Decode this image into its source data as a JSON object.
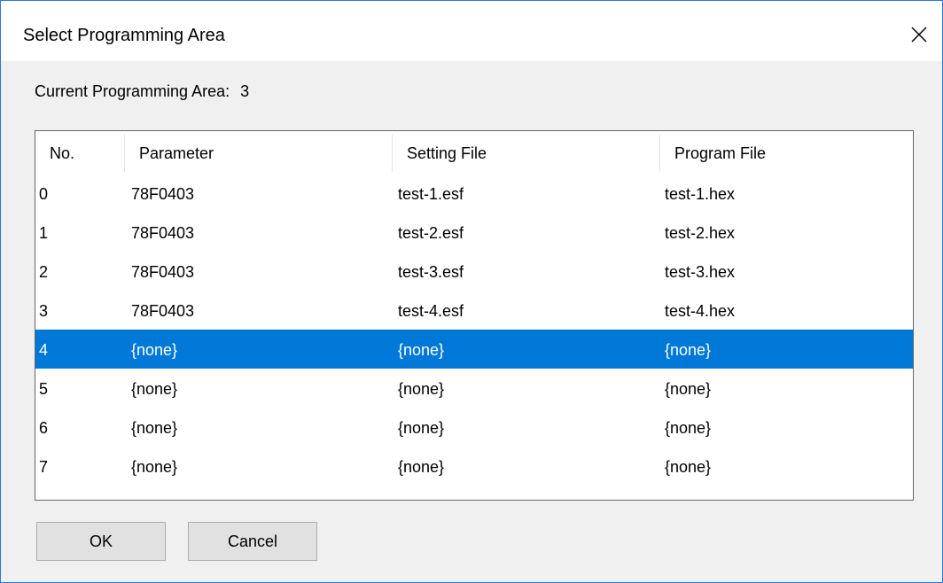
{
  "dialog": {
    "title": "Select Programming Area",
    "close_icon": "close-icon"
  },
  "current_area": {
    "label": "Current Programming Area:",
    "value": "3"
  },
  "table": {
    "columns": [
      "No.",
      "Parameter",
      "Setting File",
      "Program File"
    ],
    "selected_index": 4,
    "rows": [
      {
        "no": "0",
        "parameter": "78F0403",
        "setting_file": "test-1.esf",
        "program_file": "test-1.hex"
      },
      {
        "no": "1",
        "parameter": "78F0403",
        "setting_file": "test-2.esf",
        "program_file": "test-2.hex"
      },
      {
        "no": "2",
        "parameter": "78F0403",
        "setting_file": "test-3.esf",
        "program_file": "test-3.hex"
      },
      {
        "no": "3",
        "parameter": "78F0403",
        "setting_file": "test-4.esf",
        "program_file": "test-4.hex"
      },
      {
        "no": "4",
        "parameter": "{none}",
        "setting_file": "{none}",
        "program_file": "{none}"
      },
      {
        "no": "5",
        "parameter": "{none}",
        "setting_file": "{none}",
        "program_file": "{none}"
      },
      {
        "no": "6",
        "parameter": "{none}",
        "setting_file": "{none}",
        "program_file": "{none}"
      },
      {
        "no": "7",
        "parameter": "{none}",
        "setting_file": "{none}",
        "program_file": "{none}"
      }
    ]
  },
  "buttons": {
    "ok_label": "OK",
    "cancel_label": "Cancel"
  },
  "colors": {
    "selection": "#0078d7",
    "window_border": "#2b79d0",
    "dialog_bg": "#f0f0f0"
  }
}
